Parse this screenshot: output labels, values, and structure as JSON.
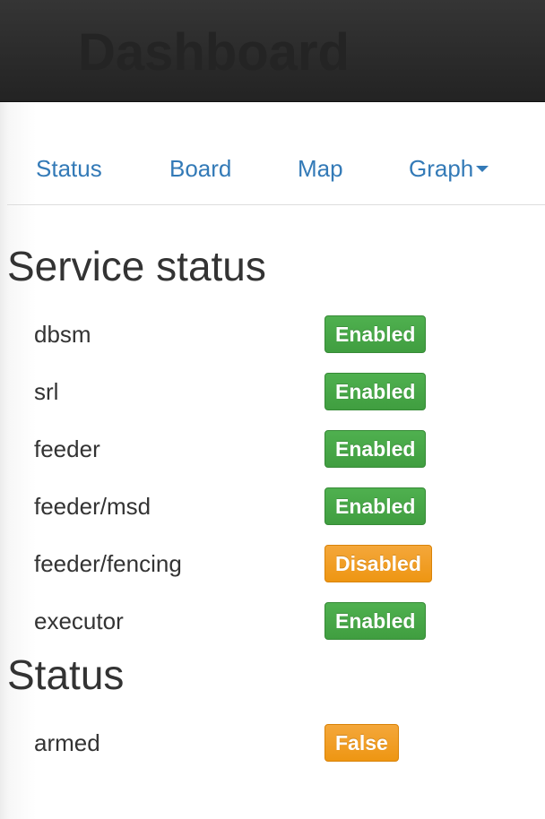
{
  "header": {
    "brand": "Dashboard"
  },
  "nav": {
    "items": [
      {
        "label": "Status"
      },
      {
        "label": "Board"
      },
      {
        "label": "Map"
      },
      {
        "label": "Graph",
        "has_dropdown": true
      }
    ]
  },
  "service_status": {
    "title": "Service status",
    "rows": [
      {
        "name": "dbsm",
        "state": "Enabled"
      },
      {
        "name": "srl",
        "state": "Enabled"
      },
      {
        "name": "feeder",
        "state": "Enabled"
      },
      {
        "name": "feeder/msd",
        "state": "Enabled"
      },
      {
        "name": "feeder/fencing",
        "state": "Disabled"
      },
      {
        "name": "executor",
        "state": "Enabled"
      }
    ]
  },
  "status": {
    "title": "Status",
    "rows": [
      {
        "name": "armed",
        "state": "False"
      }
    ]
  },
  "colors": {
    "topbar": "#2b2b2b",
    "link": "#337ab7",
    "success": "#449d44",
    "warning": "#f0ad4e"
  },
  "icons": {
    "graph_dropdown": "caret-down-icon"
  }
}
